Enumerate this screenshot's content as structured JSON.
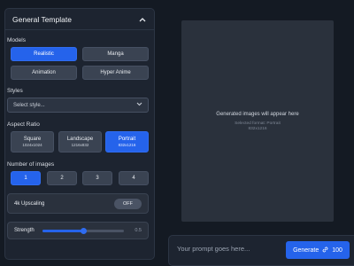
{
  "panel": {
    "title": "General Template"
  },
  "models": {
    "label": "Models",
    "options": [
      "Realistic",
      "Manga",
      "Animation",
      "Hyper Anime"
    ],
    "selected": "Realistic"
  },
  "styles": {
    "label": "Styles",
    "placeholder": "Select style..."
  },
  "aspect_ratio": {
    "label": "Aspect Ratio",
    "options": [
      {
        "name": "Square",
        "size": "1024x1024"
      },
      {
        "name": "Landscape",
        "size": "1216x832"
      },
      {
        "name": "Portrait",
        "size": "832x1216"
      }
    ],
    "selected": "Portrait"
  },
  "num_images": {
    "label": "Number of images",
    "options": [
      "1",
      "2",
      "3",
      "4"
    ],
    "selected": "1"
  },
  "upscaling": {
    "label": "4k Upscaling",
    "state": "OFF"
  },
  "strength": {
    "label": "Strength",
    "value": "0.5",
    "fraction": 0.5
  },
  "canvas": {
    "message": "Generated images will appear here",
    "format_line": "Selected format: Portrait",
    "resolution": "832x1216"
  },
  "prompt": {
    "placeholder": "Your prompt goes here..."
  },
  "generate": {
    "label": "Generate",
    "cost": "100"
  },
  "colors": {
    "accent": "#2563eb",
    "background": "#141a23",
    "panel": "#1d2430"
  }
}
